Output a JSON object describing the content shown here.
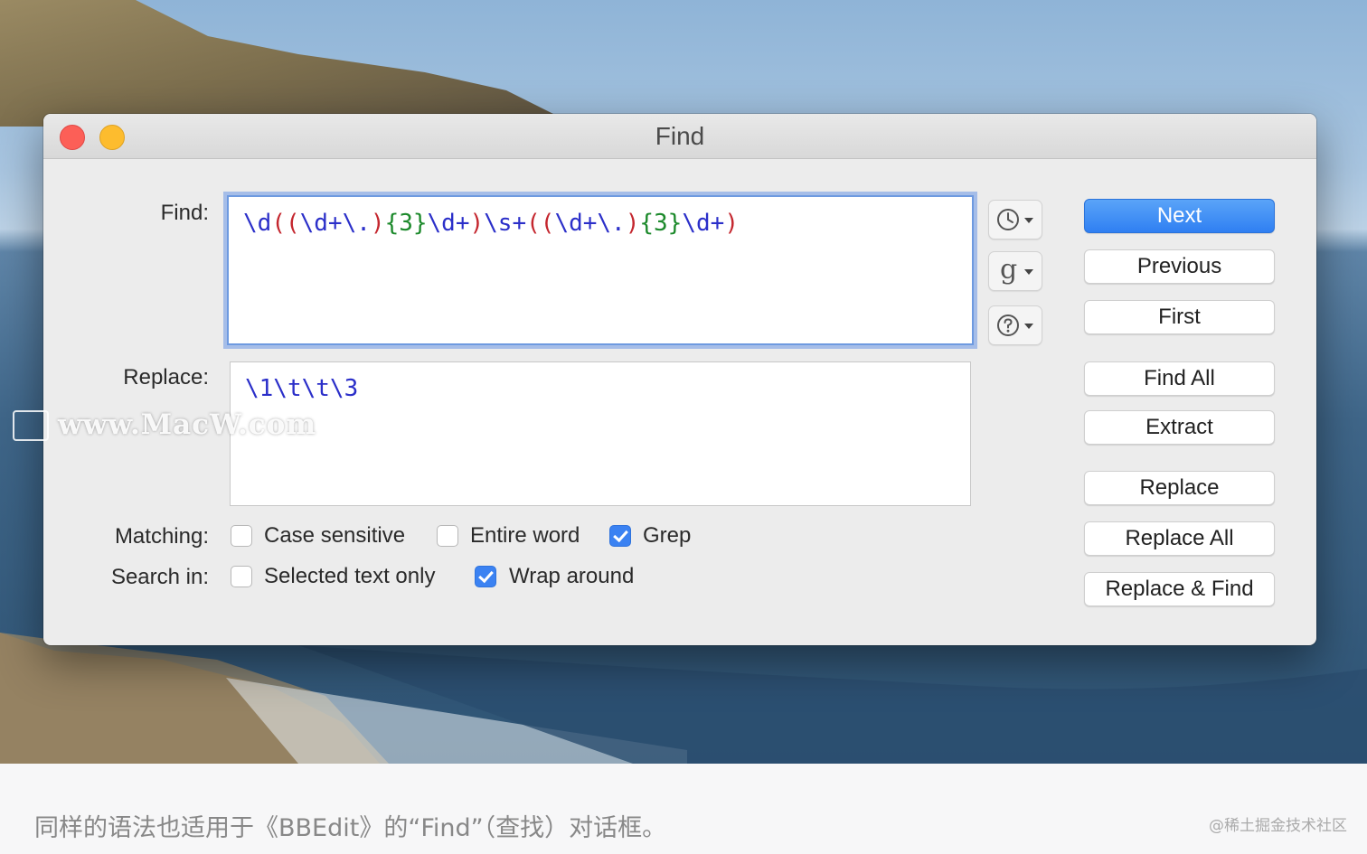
{
  "window": {
    "title": "Find",
    "traffic_lights": [
      "close",
      "minimize"
    ]
  },
  "labels": {
    "find": "Find:",
    "replace": "Replace:",
    "matching": "Matching:",
    "search_in": "Search in:"
  },
  "find_field": {
    "tokens": [
      {
        "text": "\\d",
        "kind": "esc"
      },
      {
        "text": "((",
        "kind": "grp"
      },
      {
        "text": "\\d+\\.",
        "kind": "esc"
      },
      {
        "text": ")",
        "kind": "grp"
      },
      {
        "text": "{3}",
        "kind": "qnt"
      },
      {
        "text": "\\d+",
        "kind": "esc"
      },
      {
        "text": ")",
        "kind": "grp"
      },
      {
        "text": "\\s+",
        "kind": "esc"
      },
      {
        "text": "((",
        "kind": "grp"
      },
      {
        "text": "\\d+\\.",
        "kind": "esc"
      },
      {
        "text": ")",
        "kind": "grp"
      },
      {
        "text": "{3}",
        "kind": "qnt"
      },
      {
        "text": "\\d+",
        "kind": "esc"
      },
      {
        "text": ")",
        "kind": "grp"
      }
    ]
  },
  "replace_field": {
    "value": "\\1\\t\\t\\3"
  },
  "popups": {
    "history_icon": "clock-icon",
    "grep_glyph": "g",
    "help_icon": "help-icon"
  },
  "buttons": {
    "next": "Next",
    "previous": "Previous",
    "first": "First",
    "find_all": "Find All",
    "extract": "Extract",
    "replace": "Replace",
    "replace_all": "Replace All",
    "replace_and_find": "Replace & Find"
  },
  "options": {
    "matching": [
      {
        "label": "Case sensitive",
        "checked": false
      },
      {
        "label": "Entire word",
        "checked": false
      },
      {
        "label": "Grep",
        "checked": true
      }
    ],
    "search_in": [
      {
        "label": "Selected text only",
        "checked": false
      },
      {
        "label": "Wrap around",
        "checked": true
      }
    ]
  },
  "colors": {
    "accent": "#3b82f2",
    "regex_escape": "#2b2fc9",
    "regex_group": "#c4262e",
    "regex_quantifier": "#1d8a2c"
  },
  "watermark": "www.MacW.com",
  "caption": "同样的语法也适用于《BBEdit》的“Find”（查找）对话框。",
  "credit": "@稀土掘金技术社区"
}
